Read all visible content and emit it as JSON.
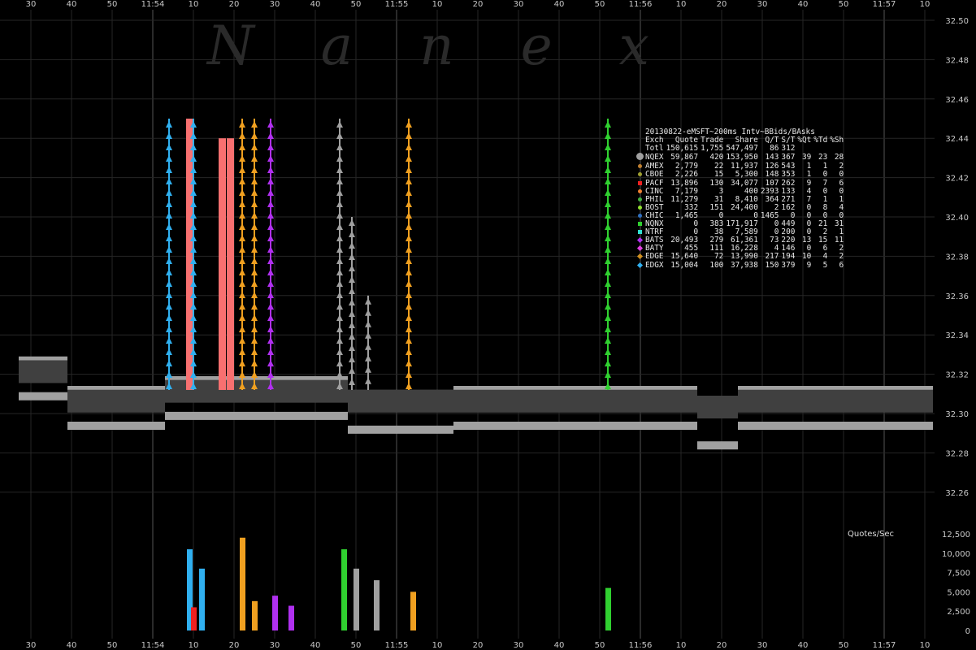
{
  "watermark": "Nanex",
  "x_axis_ticks": [
    "30",
    "40",
    "50",
    "11:54",
    "10",
    "20",
    "30",
    "40",
    "50",
    "11:55",
    "10",
    "20",
    "30",
    "40",
    "50",
    "11:56",
    "10",
    "20",
    "30",
    "40",
    "50",
    "11:57",
    "10"
  ],
  "upper_y_ticks": [
    "32.50",
    "32.48",
    "32.46",
    "32.44",
    "32.42",
    "32.40",
    "32.38",
    "32.36",
    "32.34",
    "32.32",
    "32.30",
    "32.28",
    "32.26"
  ],
  "lower_y_ticks": [
    "12,500",
    "10,000",
    "7,500",
    "5,000",
    "2,500",
    "0"
  ],
  "lower_label": "Quotes/Sec",
  "colors": {
    "background": "#000000",
    "grid": "#3a3a3a",
    "nbbo_spread": "#404040",
    "quote_gray": "#a0a0a0",
    "salmon": "#f87070",
    "purple": "#b030f0",
    "orange": "#f0a020",
    "cyan": "#30b0f0",
    "green": "#30d030",
    "red": "#f02020"
  },
  "legend": {
    "title": "20130822-eMSFT~200ms Intv~BBids/BAsks",
    "headers": [
      "Exch",
      "Quote",
      "Trade",
      "Share",
      "Q/T",
      "S/T",
      "%Qt",
      "%Td",
      "%Sh"
    ],
    "rows": [
      {
        "exch": "Totl",
        "quote": "150,615",
        "trade": "1,755",
        "share": "547,497",
        "qt": "86",
        "st": "312",
        "pqt": "",
        "ptd": "",
        "psh": "",
        "color": "",
        "marker": "none"
      },
      {
        "exch": "NQEX",
        "quote": "59,867",
        "trade": "420",
        "share": "153,950",
        "qt": "143",
        "st": "367",
        "pqt": "39",
        "ptd": "23",
        "psh": "28",
        "color": "#a0a0a0",
        "marker": "big-dot"
      },
      {
        "exch": "AMEX",
        "quote": "2,779",
        "trade": "22",
        "share": "11,937",
        "qt": "126",
        "st": "543",
        "pqt": "1",
        "ptd": "1",
        "psh": "2",
        "color": "#c08030",
        "marker": "dot"
      },
      {
        "exch": "CBOE",
        "quote": "2,226",
        "trade": "15",
        "share": "5,300",
        "qt": "148",
        "st": "353",
        "pqt": "1",
        "ptd": "0",
        "psh": "0",
        "color": "#a0a030",
        "marker": "dot"
      },
      {
        "exch": "PACF",
        "quote": "13,896",
        "trade": "130",
        "share": "34,077",
        "qt": "107",
        "st": "262",
        "pqt": "9",
        "ptd": "7",
        "psh": "6",
        "color": "#f02020",
        "marker": "square"
      },
      {
        "exch": "CINC",
        "quote": "7,179",
        "trade": "3",
        "share": "400",
        "qt": "2393",
        "st": "133",
        "pqt": "4",
        "ptd": "0",
        "psh": "0",
        "color": "#f08030",
        "marker": "dot"
      },
      {
        "exch": "PHIL",
        "quote": "11,279",
        "trade": "31",
        "share": "8,410",
        "qt": "364",
        "st": "271",
        "pqt": "7",
        "ptd": "1",
        "psh": "1",
        "color": "#40b040",
        "marker": "dot"
      },
      {
        "exch": "BOST",
        "quote": "332",
        "trade": "151",
        "share": "24,400",
        "qt": "2",
        "st": "162",
        "pqt": "0",
        "ptd": "8",
        "psh": "4",
        "color": "#90e030",
        "marker": "dot"
      },
      {
        "exch": "CHIC",
        "quote": "1,465",
        "trade": "0",
        "share": "0",
        "qt": "1465",
        "st": "0",
        "pqt": "0",
        "ptd": "0",
        "psh": "0",
        "color": "#3070c0",
        "marker": "dot"
      },
      {
        "exch": "NQNX",
        "quote": "0",
        "trade": "383",
        "share": "171,917",
        "qt": "0",
        "st": "449",
        "pqt": "0",
        "ptd": "21",
        "psh": "31",
        "color": "#30d030",
        "marker": "square"
      },
      {
        "exch": "NTRF",
        "quote": "0",
        "trade": "38",
        "share": "7,589",
        "qt": "0",
        "st": "200",
        "pqt": "0",
        "ptd": "2",
        "psh": "1",
        "color": "#30e0d0",
        "marker": "square"
      },
      {
        "exch": "BATS",
        "quote": "20,493",
        "trade": "279",
        "share": "61,361",
        "qt": "73",
        "st": "220",
        "pqt": "13",
        "ptd": "15",
        "psh": "11",
        "color": "#b030f0",
        "marker": "diamond"
      },
      {
        "exch": "BATY",
        "quote": "455",
        "trade": "111",
        "share": "16,228",
        "qt": "4",
        "st": "146",
        "pqt": "0",
        "ptd": "6",
        "psh": "2",
        "color": "#e040e0",
        "marker": "diamond"
      },
      {
        "exch": "EDGE",
        "quote": "15,640",
        "trade": "72",
        "share": "13,990",
        "qt": "217",
        "st": "194",
        "pqt": "10",
        "ptd": "4",
        "psh": "2",
        "color": "#d09020",
        "marker": "diamond"
      },
      {
        "exch": "EDGX",
        "quote": "15,004",
        "trade": "100",
        "share": "37,938",
        "qt": "150",
        "st": "379",
        "pqt": "9",
        "ptd": "5",
        "psh": "6",
        "color": "#30b0f0",
        "marker": "diamond"
      }
    ]
  },
  "chart_data": {
    "type": "bar",
    "title": "20130822-eMSFT~200ms Intv~BBids/BAsks",
    "x_time_range": [
      "11:53:27",
      "11:57:12"
    ],
    "upper_ylim": [
      32.25,
      32.5
    ],
    "lower_ylim": [
      0,
      12500
    ],
    "lower_ylabel": "Quotes/Sec",
    "grid": true,
    "legend_position": "top-right",
    "nbbo_segments": [
      {
        "t0": "11:53:27",
        "t1": "11:53:39",
        "bid": 32.315,
        "ask": 32.318
      },
      {
        "t0": "11:53:39",
        "t1": "11:54:03",
        "bid": 32.3,
        "ask": 32.303
      },
      {
        "t0": "11:54:03",
        "t1": "11:54:48",
        "bid": 32.305,
        "ask": 32.308
      },
      {
        "t0": "11:54:48",
        "t1": "11:55:14",
        "bid": 32.298,
        "ask": 32.303
      },
      {
        "t0": "11:55:14",
        "t1": "11:56:14",
        "bid": 32.3,
        "ask": 32.303
      },
      {
        "t0": "11:56:14",
        "t1": "11:56:24",
        "bid": 32.29,
        "ask": 32.3
      },
      {
        "t0": "11:56:24",
        "t1": "11:57:12",
        "bid": 32.3,
        "ask": 32.303
      }
    ],
    "ask_spikes": [
      {
        "t": "11:54:04",
        "high": 32.45,
        "color": "cyan"
      },
      {
        "t": "11:54:09",
        "high": 32.45,
        "color": "salmon"
      },
      {
        "t": "11:54:10",
        "high": 32.45,
        "color": "cyan"
      },
      {
        "t": "11:54:17",
        "high": 32.44,
        "color": "salmon"
      },
      {
        "t": "11:54:19",
        "high": 32.44,
        "color": "salmon"
      },
      {
        "t": "11:54:22",
        "high": 32.45,
        "color": "orange"
      },
      {
        "t": "11:54:25",
        "high": 32.45,
        "color": "orange"
      },
      {
        "t": "11:54:29",
        "high": 32.45,
        "color": "purple"
      },
      {
        "t": "11:54:46",
        "high": 32.45,
        "color": "gray"
      },
      {
        "t": "11:54:49",
        "high": 32.4,
        "color": "gray"
      },
      {
        "t": "11:54:53",
        "high": 32.36,
        "color": "gray"
      },
      {
        "t": "11:55:03",
        "high": 32.45,
        "color": "orange"
      },
      {
        "t": "11:55:52",
        "high": 32.45,
        "color": "green"
      }
    ],
    "quote_rate_bars": [
      {
        "t": "11:54:09",
        "value": 10500,
        "color": "cyan"
      },
      {
        "t": "11:54:10",
        "value": 3000,
        "color": "red"
      },
      {
        "t": "11:54:12",
        "value": 8000,
        "color": "cyan"
      },
      {
        "t": "11:54:22",
        "value": 12000,
        "color": "orange"
      },
      {
        "t": "11:54:25",
        "value": 3800,
        "color": "orange"
      },
      {
        "t": "11:54:30",
        "value": 4500,
        "color": "purple"
      },
      {
        "t": "11:54:34",
        "value": 3200,
        "color": "purple"
      },
      {
        "t": "11:54:47",
        "value": 10500,
        "color": "green"
      },
      {
        "t": "11:54:50",
        "value": 8000,
        "color": "gray"
      },
      {
        "t": "11:54:55",
        "value": 6500,
        "color": "gray"
      },
      {
        "t": "11:55:04",
        "value": 5000,
        "color": "orange"
      },
      {
        "t": "11:55:52",
        "value": 5500,
        "color": "green"
      }
    ]
  }
}
